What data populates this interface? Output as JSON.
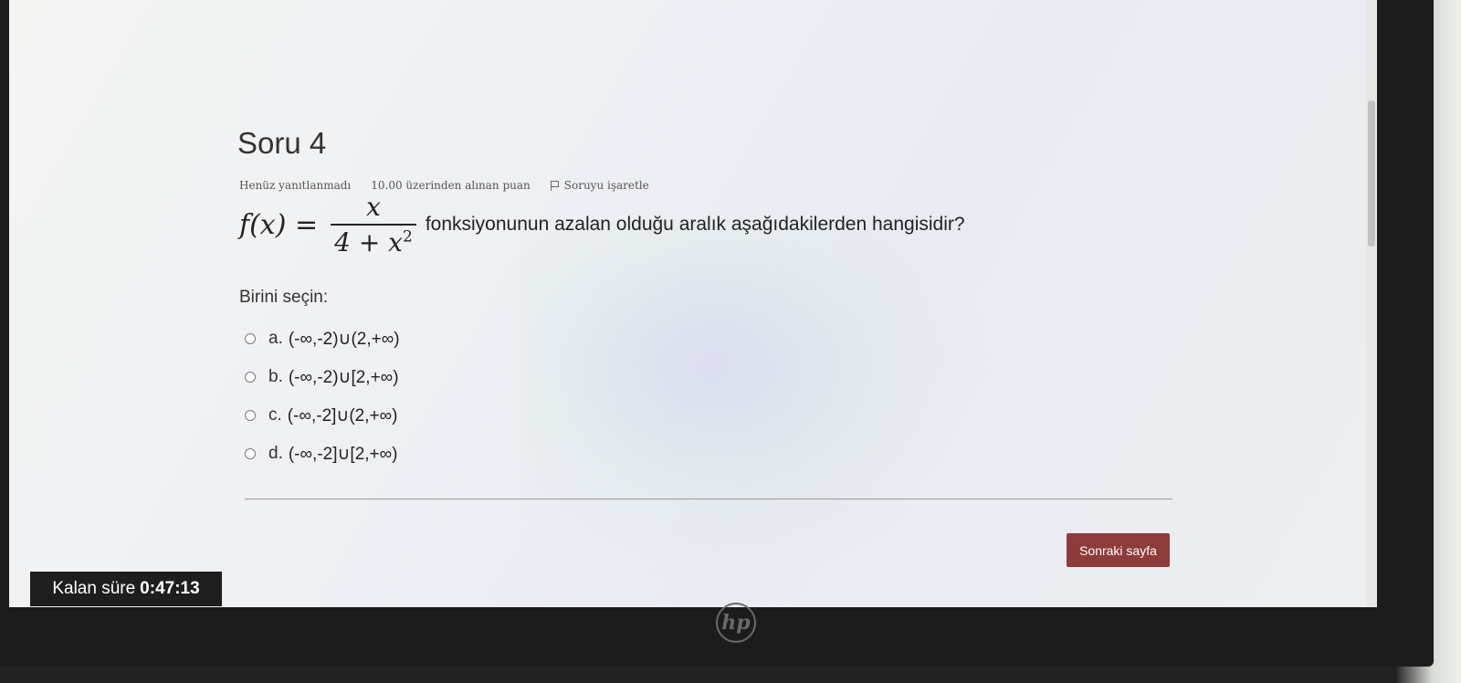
{
  "question": {
    "title": "Soru 4",
    "status": "Henüz yanıtlanmadı",
    "points": "10.00 üzerinden alınan puan",
    "flag_label": "Soruyu işaretle",
    "formula": {
      "lhs": "f(x) =",
      "numerator": "x",
      "denominator_base": "4 + x",
      "denominator_exp": "2"
    },
    "text": "fonksiyonunun azalan olduğu aralık  aşağıdakilerden hangisidir?",
    "prompt": "Birini seçin:",
    "options": [
      {
        "letter": "a.",
        "text": "(-∞,-2)∪(2,+∞)"
      },
      {
        "letter": "b.",
        "text": "(-∞,-2)∪[2,+∞)"
      },
      {
        "letter": "c.",
        "text": "(-∞,-2]∪(2,+∞)"
      },
      {
        "letter": "d.",
        "text": "(-∞,-2]∪[2,+∞)"
      }
    ]
  },
  "navigation": {
    "next_label": "Sonraki sayfa"
  },
  "timer": {
    "label": "Kalan süre",
    "value": "0:47:13"
  },
  "device": {
    "logo_text": "hp"
  },
  "colors": {
    "next_button": "#8e3b3b",
    "timer_bg": "#1e1e1e"
  }
}
